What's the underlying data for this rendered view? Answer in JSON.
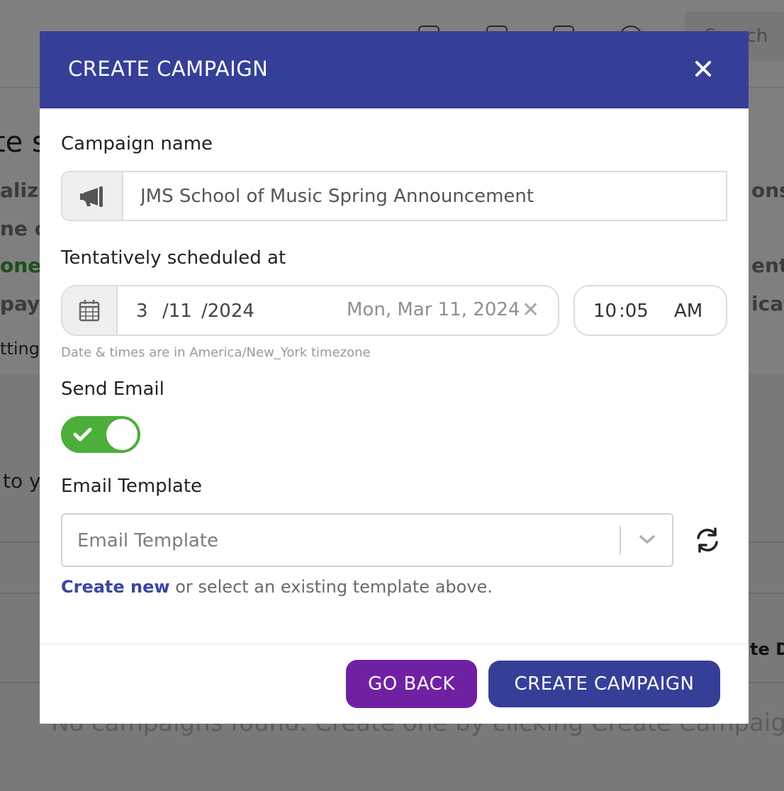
{
  "background": {
    "search_placeholder": "Search",
    "fragments": [
      "te s",
      "aliz",
      "ne o",
      "one",
      "payi",
      "tting",
      "to y",
      "ons",
      "ent",
      "icat",
      "te D"
    ],
    "empty_state": "No campaigns found. Create one by clicking Create Campaign"
  },
  "modal": {
    "title": "CREATE CAMPAIGN",
    "campaign_name": {
      "label": "Campaign name",
      "value": "JMS School of Music Spring Announcement",
      "icon": "megaphone-icon"
    },
    "schedule": {
      "label": "Tentatively scheduled at",
      "month": "3",
      "day": "/11",
      "year": "/2024",
      "display": "Mon, Mar 11, 2024",
      "hour": "10",
      "minute": ":05",
      "ampm": "AM",
      "timezone_hint": "Date & times are in America/New_York timezone"
    },
    "send_email": {
      "label": "Send Email",
      "enabled": true
    },
    "email_template": {
      "label": "Email Template",
      "placeholder": "Email Template",
      "create_link": "Create new",
      "create_help": " or select an existing template above."
    },
    "buttons": {
      "back": "GO BACK",
      "create": "CREATE CAMPAIGN"
    }
  },
  "colors": {
    "header": "#353f98",
    "back_button": "#7021a3",
    "create_button": "#353f98",
    "toggle_on": "#4caf3a",
    "link": "#3a46a4"
  }
}
